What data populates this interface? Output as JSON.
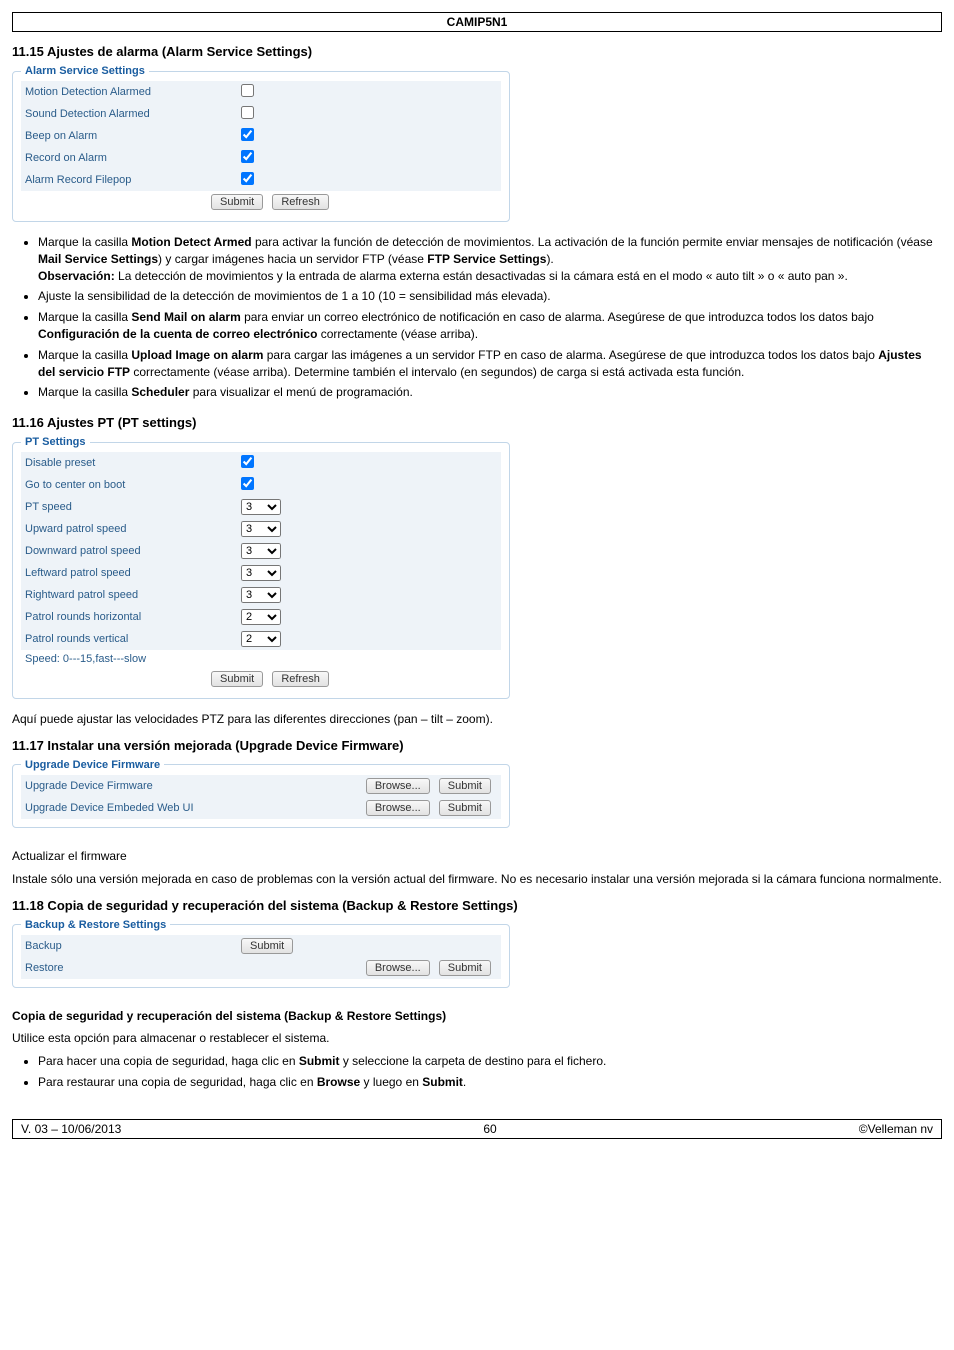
{
  "header": {
    "model": "CAMIP5N1"
  },
  "s11_15": {
    "heading": "11.15 Ajustes de alarma (Alarm Service Settings)",
    "panel_title": "Alarm Service Settings",
    "rows": {
      "r1": "Motion Detection Alarmed",
      "r2": "Sound Detection Alarmed",
      "r3": "Beep on Alarm",
      "r4": "Record on Alarm",
      "r5": "Alarm Record Filepop"
    },
    "submit": "Submit",
    "refresh": "Refresh",
    "bullets": {
      "b1a": "Marque la casilla ",
      "b1b": "Motion Detect Armed",
      "b1c": " para activar la función de detección de movimientos. La activación de la función permite enviar mensajes de notificación (véase ",
      "b1d": "Mail Service Settings",
      "b1e": ") y cargar imágenes hacia un servidor FTP (véase ",
      "b1f": "FTP Service Settings",
      "b1g": ").",
      "obs_l": "Observación:",
      "obs_t": " La detección de movimientos y la entrada de alarma externa están desactivadas si la cámara está en el modo « auto tilt » o « auto pan ».",
      "b2": "Ajuste la sensibilidad de la detección de movimientos de 1 a 10 (10 = sensibilidad más elevada).",
      "b3a": "Marque la casilla ",
      "b3b": "Send Mail on alarm",
      "b3c": " para enviar un correo electrónico de notificación en caso de alarma. Asegúrese de que introduzca todos los datos bajo ",
      "b3d": "Configuración de la cuenta de correo electrónico",
      "b3e": " correctamente (véase arriba).",
      "b4a": "Marque la casilla ",
      "b4b": "Upload Image on alarm",
      "b4c": " para cargar las imágenes a un servidor FTP en caso de alarma. Asegúrese de que introduzca todos los datos bajo ",
      "b4d": "Ajustes del servicio FTP",
      "b4e": " correctamente (véase arriba). Determine también el intervalo (en segundos) de carga si está activada esta función.",
      "b5a": "Marque la casilla ",
      "b5b": "Scheduler",
      "b5c": " para visualizar el menú de programación."
    }
  },
  "s11_16": {
    "heading": "11.16 Ajustes PT (PT settings)",
    "panel_title": "PT Settings",
    "rows": {
      "r1": "Disable preset",
      "r2": "Go to center on boot",
      "r3": "PT speed",
      "r4": "Upward patrol speed",
      "r5": "Downward patrol speed",
      "r6": "Leftward patrol speed",
      "r7": "Rightward patrol speed",
      "r8": "Patrol rounds horizontal",
      "r9": "Patrol rounds vertical",
      "r10": "Speed: 0---15,fast---slow"
    },
    "vals": {
      "v3": "3",
      "v4": "3",
      "v5": "3",
      "v6": "3",
      "v7": "3",
      "v8": "2",
      "v9": "2"
    },
    "submit": "Submit",
    "refresh": "Refresh",
    "note": "Aquí puede ajustar las velocidades PTZ para las diferentes direcciones (pan – tilt – zoom)."
  },
  "s11_17": {
    "heading": "11.17 Instalar una versión mejorada (Upgrade Device Firmware)",
    "panel_title": "Upgrade Device Firmware",
    "rows": {
      "r1": "Upgrade Device Firmware",
      "r2": "Upgrade Device Embeded Web UI"
    },
    "browse": "Browse...",
    "submit": "Submit",
    "sub_h": "Actualizar el firmware",
    "sub_t": "Instale sólo una versión mejorada en caso de problemas con la versión actual del firmware. No es necesario instalar una versión mejorada si la cámara funciona normalmente."
  },
  "s11_18": {
    "heading": "11.18 Copia de seguridad y recuperación del sistema (Backup & Restore Settings)",
    "panel_title": "Backup & Restore Settings",
    "rows": {
      "r1": "Backup",
      "r2": "Restore"
    },
    "submit": "Submit",
    "browse": "Browse...",
    "sub_h": "Copia de seguridad y recuperación del sistema (Backup & Restore Settings)",
    "sub_t": "Utilice esta opción para almacenar o restablecer el sistema.",
    "bullets": {
      "b1a": "Para hacer una copia de seguridad, haga clic en ",
      "b1b": "Submit",
      "b1c": " y seleccione la carpeta de destino para el fichero.",
      "b2a": "Para restaurar una copia de seguridad, haga clic en ",
      "b2b": "Browse",
      "b2c": " y luego en ",
      "b2d": "Submit",
      "b2e": "."
    }
  },
  "footer": {
    "left": "V. 03 – 10/06/2013",
    "center": "60",
    "right": "©Velleman nv"
  }
}
